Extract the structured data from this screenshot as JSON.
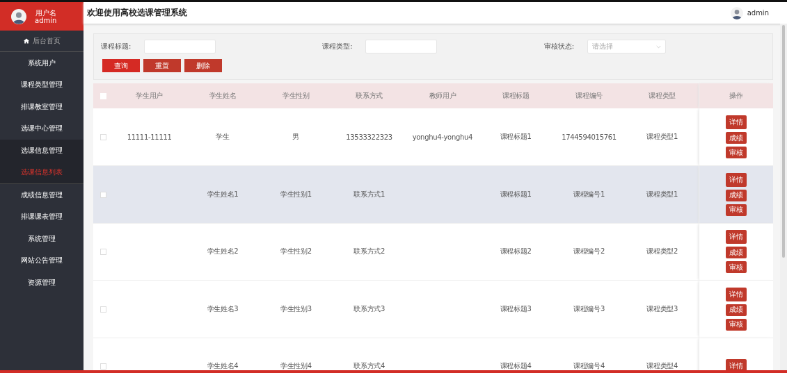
{
  "sidebar": {
    "user_label": "用户名",
    "username": "admin",
    "items": [
      {
        "label": "后台首页",
        "icon": true,
        "selected": false,
        "expanded": false
      },
      {
        "label": "系统用户",
        "icon": false,
        "selected": false,
        "expanded": false
      },
      {
        "label": "课程类型管理",
        "icon": false,
        "selected": false,
        "expanded": false
      },
      {
        "label": "排课教室管理",
        "icon": false,
        "selected": false,
        "expanded": false
      },
      {
        "label": "选课中心管理",
        "icon": false,
        "selected": false,
        "expanded": false
      },
      {
        "label": "选课信息管理",
        "icon": false,
        "selected": false,
        "expanded": true,
        "children": [
          {
            "label": "选课信息列表",
            "selected": true
          }
        ]
      },
      {
        "label": "成绩信息管理",
        "icon": false,
        "selected": false,
        "expanded": false
      },
      {
        "label": "排课课表管理",
        "icon": false,
        "selected": false,
        "expanded": false
      },
      {
        "label": "系统管理",
        "icon": false,
        "selected": false,
        "expanded": false
      },
      {
        "label": "网站公告管理",
        "icon": false,
        "selected": false,
        "expanded": false
      },
      {
        "label": "资源管理",
        "icon": false,
        "selected": false,
        "expanded": false
      }
    ]
  },
  "header": {
    "title": "欢迎使用高校选课管理系统",
    "username": "admin"
  },
  "filters": [
    {
      "kind": "text",
      "label": "课程标题:"
    },
    {
      "kind": "text",
      "label": "课程类型:"
    },
    {
      "kind": "select",
      "label": "审核状态:",
      "placeholder": "请选择"
    }
  ],
  "filter_buttons": [
    "查询",
    "重置",
    "删除"
  ],
  "table": {
    "header_checked": false,
    "columns": [
      "学生用户",
      "学生姓名",
      "学生性别",
      "联系方式",
      "教师用户",
      "课程标题",
      "课程编号",
      "课程类型",
      "操作"
    ],
    "rows": [
      {
        "checked": false,
        "highlighted": false,
        "cells": [
          "11111-11111",
          "学生",
          "男",
          "13533322323",
          "yonghu4-yonghu4",
          "课程标题1",
          "1744594015761",
          "课程类型1"
        ],
        "actions": [
          "详情",
          "成绩",
          "审核"
        ]
      },
      {
        "checked": false,
        "highlighted": true,
        "cells": [
          "",
          "学生姓名1",
          "学生性别1",
          "联系方式1",
          "",
          "课程标题1",
          "课程编号1",
          "课程类型1"
        ],
        "actions": [
          "详情",
          "成绩",
          "审核"
        ]
      },
      {
        "checked": false,
        "highlighted": false,
        "cells": [
          "",
          "学生姓名2",
          "学生性别2",
          "联系方式2",
          "",
          "课程标题2",
          "课程编号2",
          "课程类型2"
        ],
        "actions": [
          "详情",
          "成绩",
          "审核"
        ]
      },
      {
        "checked": false,
        "highlighted": false,
        "cells": [
          "",
          "学生姓名3",
          "学生性别3",
          "联系方式3",
          "",
          "课程标题3",
          "课程编号3",
          "课程类型3"
        ],
        "actions": [
          "详情",
          "成绩",
          "审核"
        ]
      },
      {
        "checked": false,
        "highlighted": false,
        "cells": [
          "",
          "学生姓名4",
          "学生性别4",
          "联系方式4",
          "",
          "课程标题4",
          "课程编号4",
          "课程类型4"
        ],
        "actions": [
          "详情"
        ]
      }
    ]
  }
}
